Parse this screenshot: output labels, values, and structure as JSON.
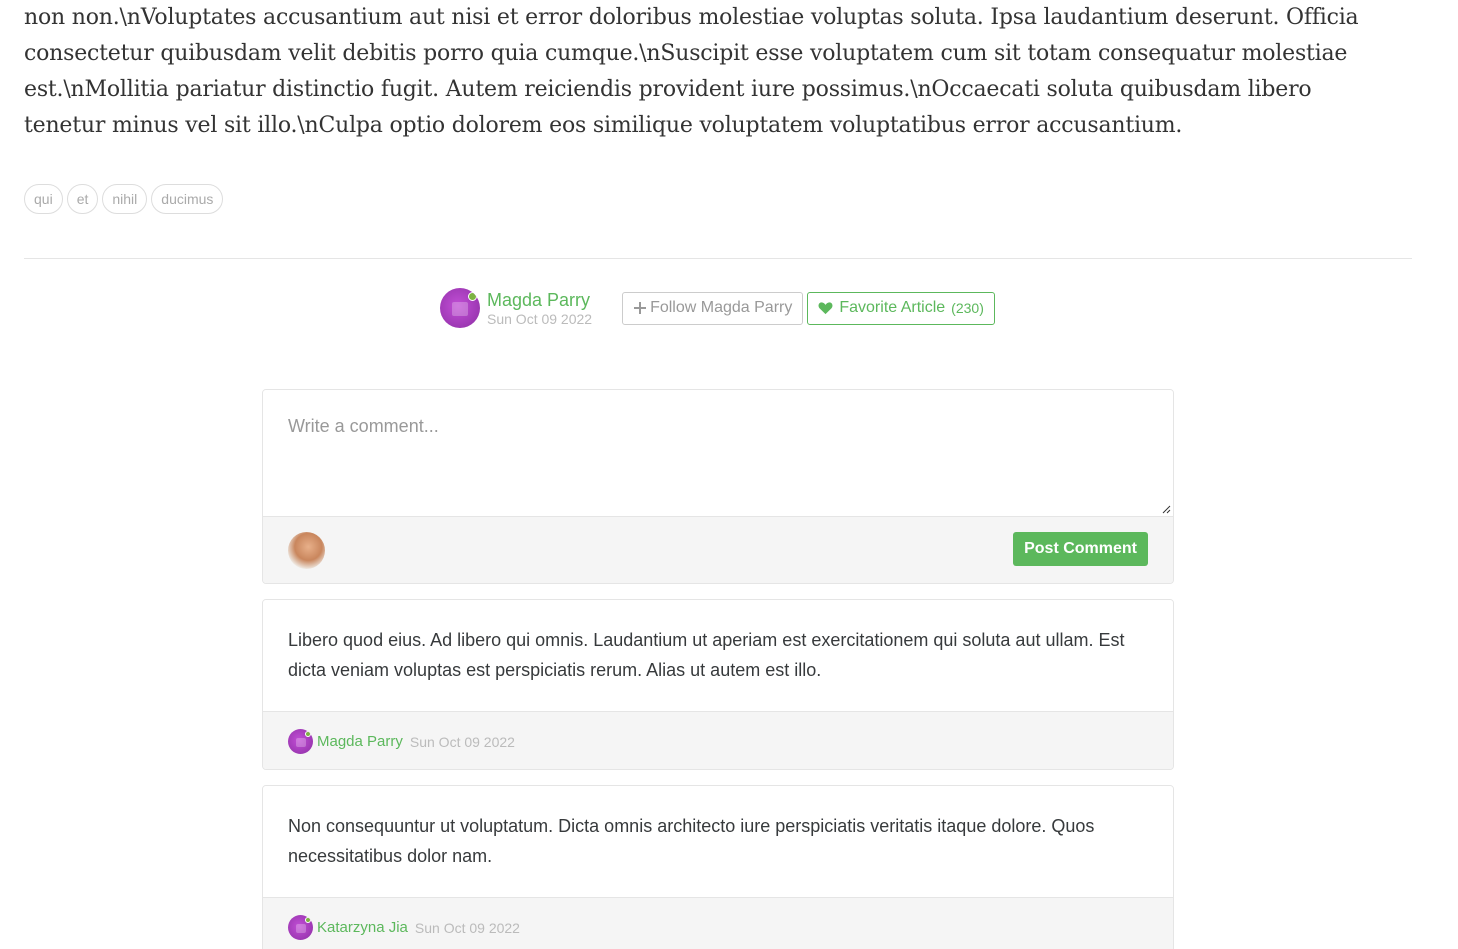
{
  "article": {
    "body": "non non.\\nVoluptates accusantium aut nisi et error doloribus molestiae voluptas soluta. Ipsa laudantium deserunt. Officia consectetur quibusdam velit debitis porro quia cumque.\\nSuscipit esse voluptatem cum sit totam consequatur molestiae est.\\nMollitia pariatur distinctio fugit. Autem reiciendis provident iure possimus.\\nOccaecati soluta quibusdam libero tenetur minus vel sit illo.\\nCulpa optio dolorem eos similique voluptatem voluptatibus error accusantium.",
    "tags": [
      "qui",
      "et",
      "nihil",
      "ducimus"
    ]
  },
  "meta": {
    "author": "Magda Parry",
    "date": "Sun Oct 09 2022",
    "follow_label": "Follow Magda Parry",
    "favorite_label": "Favorite Article",
    "favorite_count": "(230)"
  },
  "comment_form": {
    "placeholder": "Write a comment...",
    "post_label": "Post Comment"
  },
  "comments": [
    {
      "body": "Libero quod eius. Ad libero qui omnis. Laudantium ut aperiam est exercitationem qui soluta aut ullam. Est dicta veniam voluptas est perspiciatis rerum. Alias ut autem est illo.",
      "author": "Magda Parry",
      "date": "Sun Oct 09 2022"
    },
    {
      "body": "Non consequuntur ut voluptatum. Dicta omnis architecto iure perspiciatis veritatis itaque dolore. Quos necessitatibus dolor nam.",
      "author": "Katarzyna Jia",
      "date": "Sun Oct 09 2022"
    }
  ],
  "colors": {
    "accent": "#5cb85c",
    "muted": "#bbbbbb",
    "avatar_purple": "#b044c8"
  },
  "icons": {
    "follow": "plus-icon",
    "favorite": "heart-icon"
  }
}
